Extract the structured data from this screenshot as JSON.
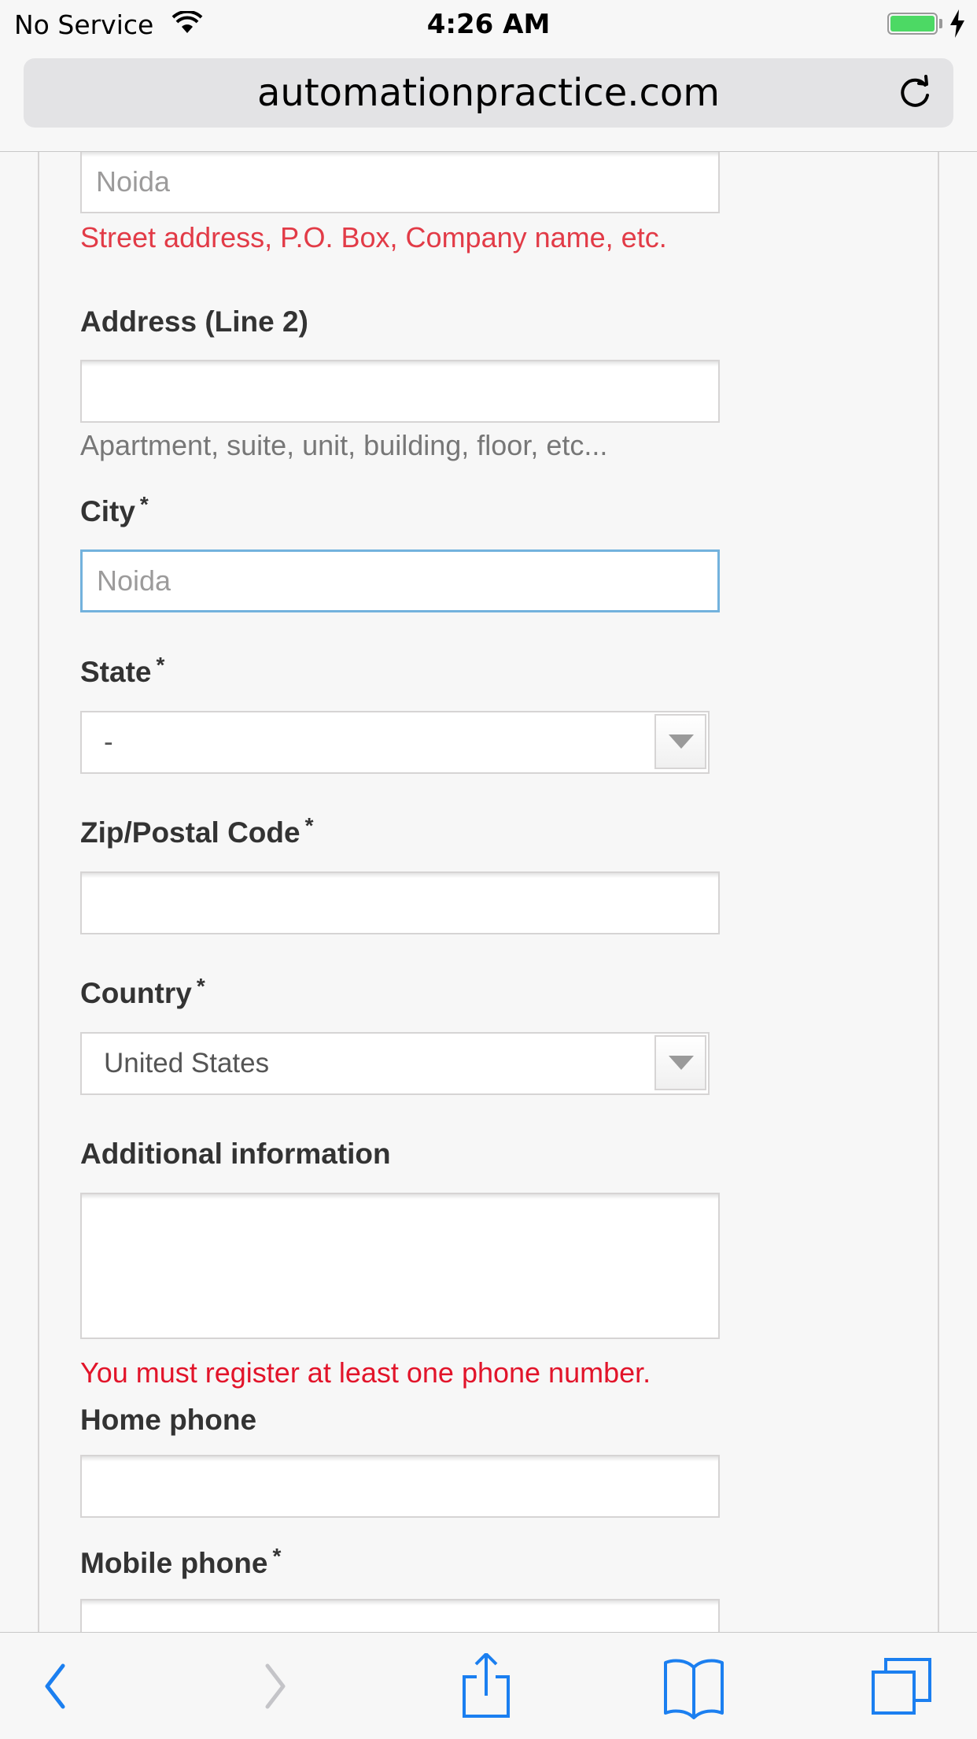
{
  "status_bar": {
    "carrier": "No Service",
    "time": "4:26 AM",
    "battery_level": 1.0
  },
  "browser": {
    "url": "automationpractice.com",
    "icons": [
      "wifi-icon",
      "battery-icon",
      "charging-icon",
      "reload-icon",
      "back-icon",
      "forward-icon",
      "share-icon",
      "bookmarks-icon",
      "tabs-icon"
    ]
  },
  "form": {
    "address1": {
      "value": "Noida",
      "hint": "Street address, P.O. Box, Company name, etc."
    },
    "address2": {
      "label": "Address (Line 2)",
      "value": "",
      "hint": "Apartment, suite, unit, building, floor, etc..."
    },
    "city": {
      "label": "City",
      "required": "*",
      "value": "Noida"
    },
    "state": {
      "label": "State",
      "required": "*",
      "selected": "-"
    },
    "zip": {
      "label": "Zip/Postal Code",
      "required": "*",
      "value": ""
    },
    "country": {
      "label": "Country",
      "required": "*",
      "selected": "United States"
    },
    "additional_info": {
      "label": "Additional information",
      "value": ""
    },
    "phone_error": "You must register at least one phone number.",
    "home_phone": {
      "label": "Home phone",
      "value": ""
    },
    "mobile_phone": {
      "label": "Mobile phone",
      "required": "*",
      "value": ""
    }
  },
  "colors": {
    "error": "#e2142a",
    "focus_border": "#73b2dd",
    "ios_blue": "#1b7ff0",
    "battery_green": "#4cd964"
  }
}
